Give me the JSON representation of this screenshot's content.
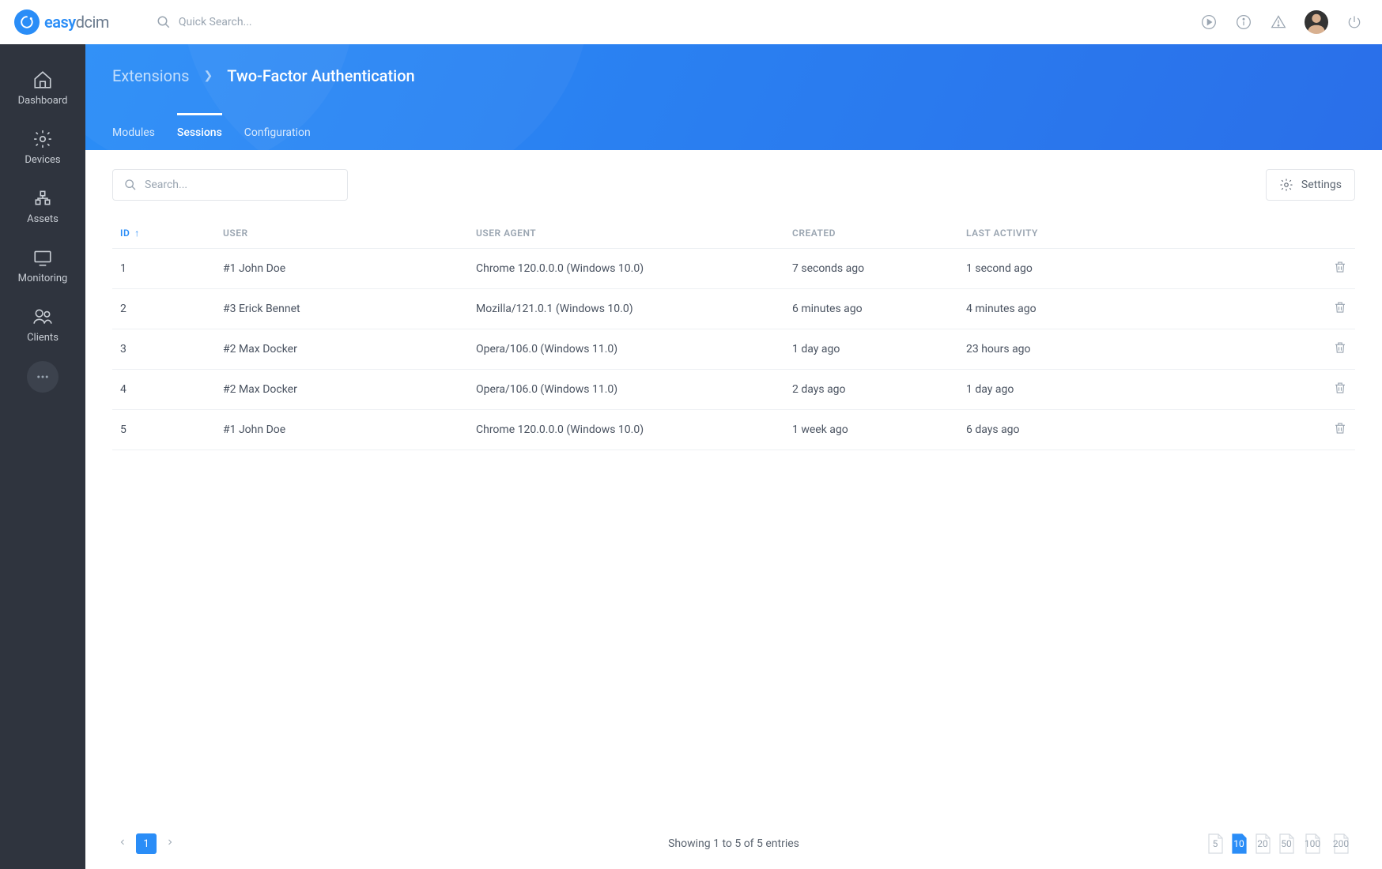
{
  "brand": {
    "name_a": "easy",
    "name_b": "dcim"
  },
  "top_search_placeholder": "Quick Search...",
  "sidebar": {
    "items": [
      {
        "label": "Dashboard"
      },
      {
        "label": "Devices"
      },
      {
        "label": "Assets"
      },
      {
        "label": "Monitoring"
      },
      {
        "label": "Clients"
      }
    ]
  },
  "breadcrumb": {
    "parent": "Extensions",
    "current": "Two-Factor Authentication"
  },
  "tabs": {
    "modules": "Modules",
    "sessions": "Sessions",
    "configuration": "Configuration",
    "active": "sessions"
  },
  "toolbar": {
    "search_placeholder": "Search...",
    "settings_label": "Settings"
  },
  "table": {
    "headers": {
      "id": "ID",
      "user": "USER",
      "user_agent": "USER AGENT",
      "created": "CREATED",
      "last_activity": "LAST ACTIVITY"
    },
    "rows": [
      {
        "id": "1",
        "user": "#1 John Doe",
        "agent": "Chrome 120.0.0.0 (Windows 10.0)",
        "created": "7 seconds ago",
        "activity": "1 second ago"
      },
      {
        "id": "2",
        "user": "#3 Erick Bennet",
        "agent": "Mozilla/121.0.1 (Windows 10.0)",
        "created": "6 minutes ago",
        "activity": "4 minutes ago"
      },
      {
        "id": "3",
        "user": "#2 Max Docker",
        "agent": "Opera/106.0 (Windows 11.0)",
        "created": "1 day ago",
        "activity": "23 hours ago"
      },
      {
        "id": "4",
        "user": "#2 Max Docker",
        "agent": "Opera/106.0 (Windows 11.0)",
        "created": "2 days ago",
        "activity": "1 day ago"
      },
      {
        "id": "5",
        "user": "#1 John Doe",
        "agent": "Chrome 120.0.0.0 (Windows 10.0)",
        "created": "1 week ago",
        "activity": "6 days ago"
      }
    ]
  },
  "footer": {
    "current_page": "1",
    "showing": "Showing 1 to 5 of 5 entries",
    "page_sizes": [
      "5",
      "10",
      "20",
      "50",
      "100",
      "200"
    ],
    "active_size": "10"
  }
}
